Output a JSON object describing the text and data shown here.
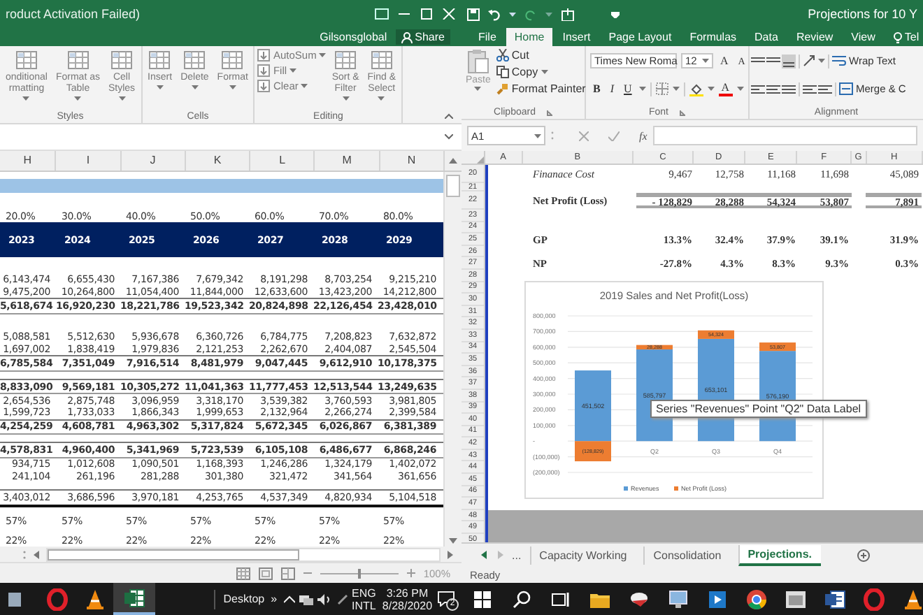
{
  "left_window": {
    "title": "roduct Activation Failed)",
    "account": "Gilsonsglobal",
    "share_button": "Share",
    "ribbon_groups": [
      {
        "label": "Styles",
        "buttons": [
          {
            "kind": "large",
            "label": "onditional\nrmatting",
            "dropdown": true
          },
          {
            "kind": "large",
            "label": "Format as\nTable",
            "dropdown": true
          },
          {
            "kind": "large",
            "label": "Cell\nStyles",
            "dropdown": true
          }
        ]
      },
      {
        "label": "Cells",
        "buttons": [
          {
            "kind": "large",
            "label": "Insert",
            "dropdown": true
          },
          {
            "kind": "large",
            "label": "Delete",
            "dropdown": true
          },
          {
            "kind": "large",
            "label": "Format",
            "dropdown": true
          }
        ]
      },
      {
        "label": "Editing",
        "buttons": [
          {
            "kind": "small",
            "label": "AutoSum",
            "dropdown": true
          },
          {
            "kind": "small",
            "label": "Fill",
            "dropdown": true
          },
          {
            "kind": "small",
            "label": "Clear",
            "dropdown": true
          },
          {
            "kind": "large",
            "label": "Sort &\nFilter",
            "dropdown": true
          },
          {
            "kind": "large",
            "label": "Find &\nSelect",
            "dropdown": true
          }
        ]
      }
    ],
    "columns": [
      "H",
      "I",
      "J",
      "K",
      "L",
      "M",
      "N"
    ],
    "rows": [
      {
        "kind": "gap"
      },
      {
        "kind": "band"
      },
      {
        "kind": "blank"
      },
      {
        "kind": "percent",
        "cells": [
          "20.0%",
          "30.0%",
          "40.0%",
          "50.0%",
          "60.0%",
          "70.0%",
          "80.0%"
        ]
      },
      {
        "kind": "header",
        "cells": [
          "2023",
          "2024",
          "2025",
          "2026",
          "2027",
          "2028",
          "2029"
        ]
      },
      {
        "kind": "blank"
      },
      {
        "kind": "value",
        "cells": [
          "6,143,474",
          "6,655,430",
          "7,167,386",
          "7,679,342",
          "8,191,298",
          "8,703,254",
          "9,215,210"
        ]
      },
      {
        "kind": "value",
        "cells": [
          "9,475,200",
          "10,264,800",
          "11,054,400",
          "11,844,000",
          "12,633,600",
          "13,423,200",
          "14,212,800"
        ]
      },
      {
        "kind": "total",
        "cells": [
          "5,618,674",
          "16,920,230",
          "18,221,786",
          "19,523,342",
          "20,824,898",
          "22,126,454",
          "23,428,010"
        ]
      },
      {
        "kind": "blank"
      },
      {
        "kind": "value",
        "cells": [
          "5,088,581",
          "5,512,630",
          "5,936,678",
          "6,360,726",
          "6,784,775",
          "7,208,823",
          "7,632,872"
        ]
      },
      {
        "kind": "value",
        "cells": [
          "1,697,002",
          "1,838,419",
          "1,979,836",
          "2,121,253",
          "2,262,670",
          "2,404,087",
          "2,545,504"
        ]
      },
      {
        "kind": "total",
        "cells": [
          "6,785,584",
          "7,351,049",
          "7,916,514",
          "8,481,979",
          "9,047,445",
          "9,612,910",
          "10,178,375"
        ]
      },
      {
        "kind": "gap"
      },
      {
        "kind": "total",
        "cells": [
          "8,833,090",
          "9,569,181",
          "10,305,272",
          "11,041,363",
          "11,777,453",
          "12,513,544",
          "13,249,635"
        ]
      },
      {
        "kind": "value",
        "cells": [
          "2,654,536",
          "2,875,748",
          "3,096,959",
          "3,318,170",
          "3,539,382",
          "3,760,593",
          "3,981,805"
        ]
      },
      {
        "kind": "value",
        "cells": [
          "1,599,723",
          "1,733,033",
          "1,866,343",
          "1,999,653",
          "2,132,964",
          "2,266,274",
          "2,399,584"
        ]
      },
      {
        "kind": "total",
        "cells": [
          "4,254,259",
          "4,608,781",
          "4,963,302",
          "5,317,824",
          "5,672,345",
          "6,026,867",
          "6,381,389"
        ]
      },
      {
        "kind": "gap"
      },
      {
        "kind": "total",
        "cells": [
          "4,578,831",
          "4,960,400",
          "5,341,969",
          "5,723,539",
          "6,105,108",
          "6,486,677",
          "6,868,246"
        ]
      },
      {
        "kind": "value",
        "cells": [
          "934,715",
          "1,012,608",
          "1,090,501",
          "1,168,393",
          "1,246,286",
          "1,324,179",
          "1,402,072"
        ]
      },
      {
        "kind": "value",
        "cells": [
          "241,104",
          "261,196",
          "281,288",
          "301,380",
          "321,472",
          "341,564",
          "361,656"
        ]
      },
      {
        "kind": "gap"
      },
      {
        "kind": "final",
        "cells": [
          "3,403,012",
          "3,686,596",
          "3,970,181",
          "4,253,765",
          "4,537,349",
          "4,820,934",
          "5,104,518"
        ]
      },
      {
        "kind": "gap"
      },
      {
        "kind": "percent",
        "cells": [
          "57%",
          "57%",
          "57%",
          "57%",
          "57%",
          "57%",
          "57%"
        ]
      },
      {
        "kind": "gap"
      },
      {
        "kind": "percent",
        "cells": [
          "22%",
          "22%",
          "22%",
          "22%",
          "22%",
          "22%",
          "22%"
        ]
      }
    ],
    "zoom_slider": {
      "level": 0.5
    },
    "zoom_level": "100%"
  },
  "right_window": {
    "title": "Projections for 10 Y",
    "tabs": [
      {
        "kind": "tab",
        "label": "File",
        "selected": false
      },
      {
        "kind": "tab",
        "label": "Home",
        "selected": true
      },
      {
        "kind": "tab",
        "label": "Insert",
        "selected": false
      },
      {
        "kind": "tab",
        "label": "Page Layout",
        "selected": false
      },
      {
        "kind": "tab",
        "label": "Formulas",
        "selected": false
      },
      {
        "kind": "tab",
        "label": "Data",
        "selected": false
      },
      {
        "kind": "tab",
        "label": "Review",
        "selected": false
      },
      {
        "kind": "tab",
        "label": "View",
        "selected": false
      },
      {
        "kind": "tell_me",
        "label": "Tel",
        "selected": false
      }
    ],
    "clipboard": {
      "label": "Clipboard",
      "paste": "Paste",
      "actions": [
        {
          "label": "Cut",
          "dropdown": false
        },
        {
          "label": "Copy",
          "dropdown": true
        },
        {
          "label": "Format Painter",
          "dropdown": false
        }
      ]
    },
    "font": {
      "label": "Font",
      "font_name": "Times New Roma",
      "font_size": "12",
      "grow": "A",
      "shrink": "A",
      "styles": [
        "B",
        "I",
        "U"
      ],
      "font_color": "A"
    },
    "alignment": {
      "label": "Alignment",
      "wrap_text": "Wrap Text",
      "merge": "Merge & C"
    },
    "name_box": "A1",
    "function_label": "fx",
    "columns": [
      "A",
      "B",
      "C",
      "D",
      "E",
      "F",
      "G",
      "H"
    ],
    "rows": [
      {
        "number": "20",
        "kind": "italic",
        "cells": {
          "B": "Finanace Cost",
          "C": "9,467",
          "D": "12,758",
          "E": "11,168",
          "F": "11,698",
          "H": "45,089"
        }
      },
      {
        "number": "21",
        "kind": "blank"
      },
      {
        "number": "22",
        "kind": "total",
        "cells": {
          "B": "Net Profit (Loss)",
          "C": "- 128,829",
          "D": "28,288",
          "E": "54,324",
          "F": "53,807",
          "H": "7,891"
        }
      },
      {
        "number": "23",
        "kind": "blank"
      },
      {
        "number": "24",
        "kind": "blank"
      },
      {
        "number": "25",
        "kind": "bold",
        "cells": {
          "B": "GP",
          "C": "13.3%",
          "D": "32.4%",
          "E": "37.9%",
          "F": "39.1%",
          "H": "31.9%"
        }
      },
      {
        "number": "26",
        "kind": "blank"
      },
      {
        "number": "27",
        "kind": "bold",
        "cells": {
          "B": "NP",
          "C": "-27.8%",
          "D": "4.3%",
          "E": "8.3%",
          "F": "9.3%",
          "H": "0.3%"
        }
      },
      {
        "number": "28",
        "kind": "blank"
      },
      {
        "number": "29",
        "kind": "blank"
      },
      {
        "number": "30",
        "kind": "blank"
      },
      {
        "number": "31",
        "kind": "blank"
      },
      {
        "number": "32",
        "kind": "blank"
      },
      {
        "number": "33",
        "kind": "blank"
      },
      {
        "number": "34",
        "kind": "blank"
      },
      {
        "number": "35",
        "kind": "blank"
      },
      {
        "number": "36",
        "kind": "blank"
      },
      {
        "number": "37",
        "kind": "blank"
      },
      {
        "number": "38",
        "kind": "blank"
      },
      {
        "number": "39",
        "kind": "blank"
      },
      {
        "number": "40",
        "kind": "blank"
      },
      {
        "number": "41",
        "kind": "blank"
      },
      {
        "number": "42",
        "kind": "blank"
      },
      {
        "number": "43",
        "kind": "blank"
      },
      {
        "number": "44",
        "kind": "blank"
      },
      {
        "number": "45",
        "kind": "blank"
      },
      {
        "number": "46",
        "kind": "blank"
      },
      {
        "number": "47",
        "kind": "blank"
      },
      {
        "number": "48",
        "kind": "outside"
      },
      {
        "number": "49",
        "kind": "outside"
      },
      {
        "number": "50",
        "kind": "outside"
      }
    ],
    "chart": {
      "chart_data": {
        "type": "bar",
        "title": "2019 Sales and Net Profit(Loss)",
        "categories": [
          null,
          "Q2",
          "Q3",
          "Q4"
        ],
        "stacked": true,
        "grid": true,
        "legend": "bottom",
        "ylim": [
          -200000,
          800000
        ],
        "value_labels": [
          [
            "451,502",
            "585,797",
            "653,101",
            "576,190"
          ],
          [
            "(128,829)",
            "28,288",
            "54,324",
            "53,807"
          ]
        ],
        "yticks": [
          {
            "value": 800000,
            "label": "800,000"
          },
          {
            "value": 700000,
            "label": "700,000"
          },
          {
            "value": 600000,
            "label": "600,000"
          },
          {
            "value": 500000,
            "label": "500,000"
          },
          {
            "value": 400000,
            "label": "400,000"
          },
          {
            "value": 300000,
            "label": "300,000"
          },
          {
            "value": 200000,
            "label": "200,000"
          },
          {
            "value": 100000,
            "label": "100,000"
          },
          {
            "value": 0,
            "label": "-"
          },
          {
            "value": -100000,
            "label": "(100,000)"
          },
          {
            "value": -200000,
            "label": "(200,000)"
          }
        ],
        "series": [
          {
            "name": "Revenues",
            "color": "#5b9bd5",
            "values": [
              451502,
              585797,
              653101,
              576190
            ]
          },
          {
            "name": "Net Profit (Loss)",
            "color": "#ed7d31",
            "values": [
              -128829,
              28288,
              54324,
              53807
            ]
          }
        ]
      }
    },
    "tooltip": "Series \"Revenues\" Point \"Q2\" Data Label",
    "sheet_nav_more": "...",
    "sheet_tabs": [
      {
        "label": "Capacity Working",
        "selected": false
      },
      {
        "label": "Consolidation",
        "selected": false
      },
      {
        "label": "Projections.",
        "selected": true
      }
    ],
    "status": "Ready"
  },
  "left_taskbar": {
    "apps": [
      {
        "kind": "tile",
        "active": false
      },
      {
        "kind": "opera",
        "active": false
      },
      {
        "kind": "vlc",
        "active": false
      },
      {
        "kind": "excel",
        "active": true
      }
    ],
    "desktop": "Desktop",
    "overflow": "»",
    "language_top": "ENG",
    "language_bottom": "INTL",
    "time": "3:26 PM",
    "date": "8/28/2020",
    "notifications": "2"
  },
  "right_taskbar": {
    "apps": [
      {
        "kind": "start",
        "active": false
      },
      {
        "kind": "search",
        "active": false
      },
      {
        "kind": "taskview",
        "active": false
      },
      {
        "kind": "folder",
        "active": false
      },
      {
        "kind": "remote",
        "active": false
      },
      {
        "kind": "computer",
        "active": false
      },
      {
        "kind": "media",
        "active": false
      },
      {
        "kind": "chrome",
        "active": false
      },
      {
        "kind": "window",
        "active": false
      },
      {
        "kind": "word",
        "active": false
      },
      {
        "kind": "opera",
        "active": false
      },
      {
        "kind": "vlc",
        "active": false
      }
    ]
  }
}
